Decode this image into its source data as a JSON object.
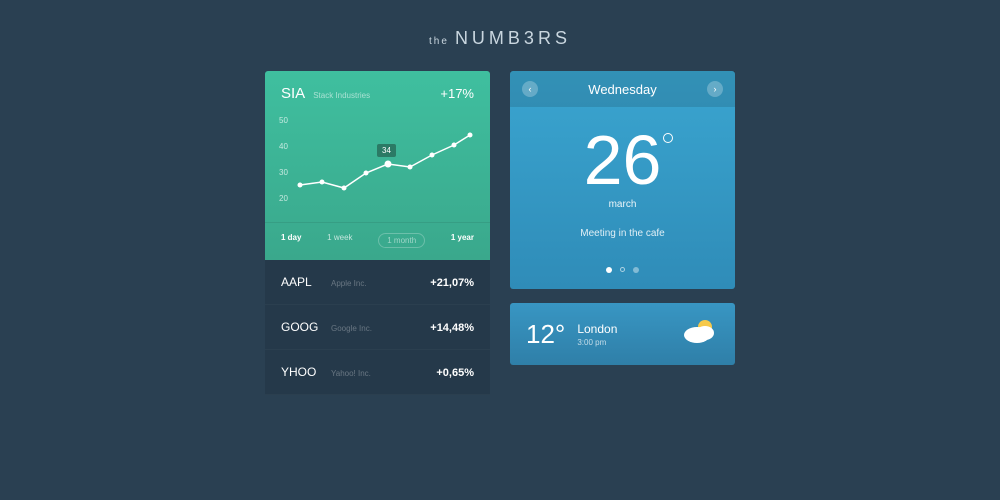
{
  "title": {
    "prefix": "the",
    "main": "NUMB3RS"
  },
  "stock": {
    "symbol": "SIA",
    "name": "Stack Industries",
    "change": "+17%",
    "yticks": [
      "50",
      "40",
      "30",
      "20"
    ],
    "callout": "34",
    "tabs": {
      "day": "1 day",
      "week": "1 week",
      "month": "1 month",
      "year": "1 year"
    }
  },
  "chart_data": {
    "type": "line",
    "x": [
      1,
      2,
      3,
      4,
      5,
      6,
      7,
      8,
      9
    ],
    "values": [
      27,
      28,
      26,
      31,
      34,
      33,
      37,
      40,
      44
    ],
    "ylim": [
      20,
      50
    ],
    "highlight": {
      "x": 5,
      "value": 34
    }
  },
  "list": [
    {
      "symbol": "AAPL",
      "name": "Apple Inc.",
      "change": "+21,07%"
    },
    {
      "symbol": "GOOG",
      "name": "Google Inc.",
      "change": "+14,48%"
    },
    {
      "symbol": "YHOO",
      "name": "Yahoo! Inc.",
      "change": "+0,65%"
    }
  ],
  "calendar": {
    "weekday": "Wednesday",
    "date": "26",
    "month": "march",
    "event": "Meeting in the cafe"
  },
  "weather": {
    "temp": "12°",
    "city": "London",
    "time": "3:00 pm"
  }
}
